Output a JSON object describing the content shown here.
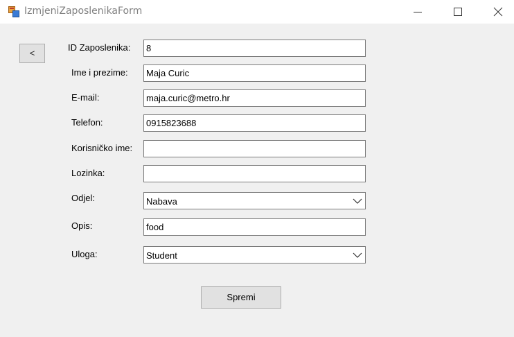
{
  "window": {
    "title": "IzmjeniZaposlenikaForm",
    "icon": "winforms-app-icon"
  },
  "toolbar": {
    "back_label": "<"
  },
  "form": {
    "id": {
      "label": "ID Zaposlenika:",
      "value": "8"
    },
    "name": {
      "label": "Ime i prezime:",
      "value": "Maja Curic"
    },
    "email": {
      "label": "E-mail:",
      "value": "maja.curic@metro.hr"
    },
    "phone": {
      "label": "Telefon:",
      "value": "0915823688"
    },
    "username": {
      "label": "Korisničko ime:",
      "value": ""
    },
    "password": {
      "label": "Lozinka:",
      "value": ""
    },
    "department": {
      "label": "Odjel:",
      "selected": "Nabava"
    },
    "description": {
      "label": "Opis:",
      "value": "food"
    },
    "role": {
      "label": "Uloga:",
      "selected": "Student"
    }
  },
  "actions": {
    "save_label": "Spremi"
  },
  "colors": {
    "window_bg": "#f0f0f0",
    "titlebar_bg": "#ffffff",
    "button_bg": "#e1e1e1",
    "field_border": "#7a7a7a"
  }
}
